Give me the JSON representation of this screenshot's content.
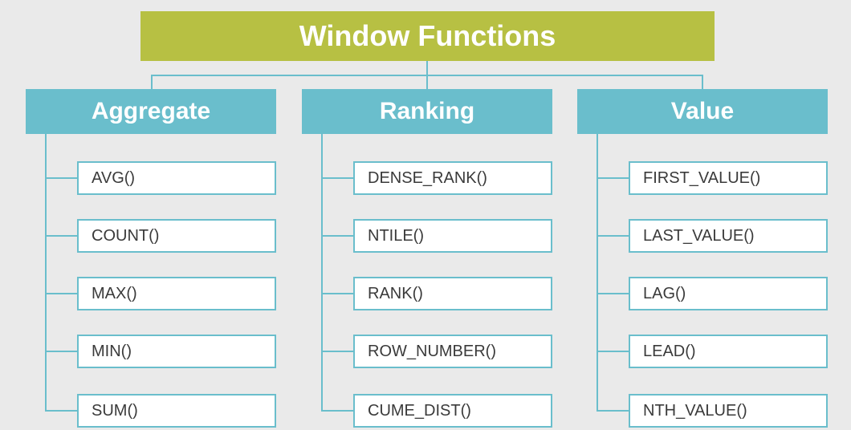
{
  "title": "Window Functions",
  "colors": {
    "title_bg": "#b7c043",
    "category_bg": "#6abecc",
    "box_border": "#6abecc",
    "page_bg": "#eaeaea",
    "text_light": "#ffffff",
    "text_dark": "#3a3a3a"
  },
  "categories": [
    {
      "name": "Aggregate",
      "functions": [
        "AVG()",
        "COUNT()",
        "MAX()",
        "MIN()",
        "SUM()"
      ]
    },
    {
      "name": "Ranking",
      "functions": [
        "DENSE_RANK()",
        "NTILE()",
        "RANK()",
        "ROW_NUMBER()",
        "CUME_DIST()"
      ]
    },
    {
      "name": "Value",
      "functions": [
        "FIRST_VALUE()",
        "LAST_VALUE()",
        "LAG()",
        "LEAD()",
        "NTH_VALUE()"
      ]
    }
  ]
}
